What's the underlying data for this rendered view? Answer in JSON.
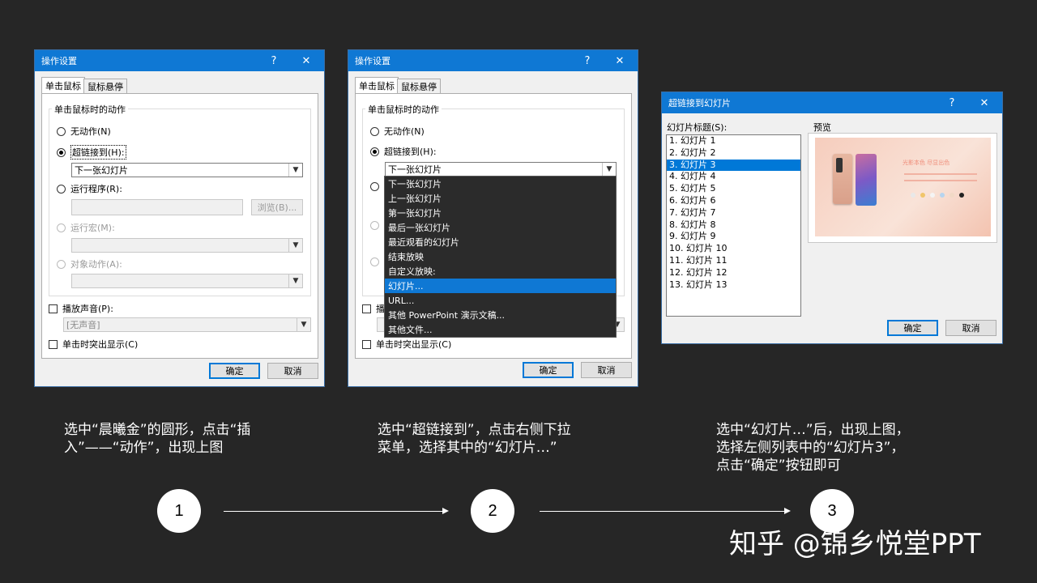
{
  "dialog1": {
    "title": "操作设置",
    "help": "?",
    "close": "✕",
    "tabs": [
      "单击鼠标",
      "鼠标悬停"
    ],
    "group_label": "单击鼠标时的动作",
    "radio_none": "无动作(N)",
    "radio_hyperlink": "超链接到(H):",
    "hyperlink_value": "下一张幻灯片",
    "radio_program": "运行程序(R):",
    "browse": "浏览(B)...",
    "radio_macro": "运行宏(M):",
    "radio_object": "对象动作(A):",
    "check_sound": "播放声音(P):",
    "sound_value": "[无声音]",
    "check_highlight": "单击时突出显示(C)",
    "ok": "确定",
    "cancel": "取消"
  },
  "dialog2": {
    "title": "操作设置",
    "help": "?",
    "close": "✕",
    "tabs": [
      "单击鼠标",
      "鼠标悬停"
    ],
    "group_label": "单击鼠标时的动作",
    "radio_none": "无动作(N)",
    "radio_hyperlink": "超链接到(H):",
    "hyperlink_value": "下一张幻灯片",
    "dropdown_items": [
      "下一张幻灯片",
      "上一张幻灯片",
      "第一张幻灯片",
      "最后一张幻灯片",
      "最近观看的幻灯片",
      "结束放映",
      "自定义放映:",
      "幻灯片...",
      "URL...",
      "其他 PowerPoint 演示文稿...",
      "其他文件..."
    ],
    "selected_index": 7,
    "check_sound_partial": "播",
    "check_highlight_partial": "单击时突出显示(C)",
    "ok": "确定",
    "cancel": "取消"
  },
  "dialog3": {
    "title": "超链接到幻灯片",
    "help": "?",
    "close": "✕",
    "list_label": "幻灯片标题(S):",
    "preview_label": "预览",
    "slides": [
      "1. 幻灯片 1",
      "2. 幻灯片 2",
      "3. 幻灯片 3",
      "4. 幻灯片 4",
      "5. 幻灯片 5",
      "6. 幻灯片 6",
      "7. 幻灯片 7",
      "8. 幻灯片 8",
      "9. 幻灯片 9",
      "10. 幻灯片 10",
      "11. 幻灯片 11",
      "12. 幻灯片 12",
      "13. 幻灯片 13"
    ],
    "selected_index": 2,
    "preview_heading": "光影本色  尽显出色",
    "ok": "确定",
    "cancel": "取消"
  },
  "captions": {
    "step1": [
      "选中“晨曦金”的圆形，点击“插",
      "入”——“动作”，出现上图"
    ],
    "step2": [
      "选中“超链接到”，点击右侧下拉",
      "菜单，选择其中的“幻灯片…”"
    ],
    "step3": [
      "选中“幻灯片…”后，出现上图，",
      "选择左侧列表中的“幻灯片3”，",
      "点击“确定”按钮即可"
    ]
  },
  "steps": [
    "1",
    "2",
    "3"
  ],
  "watermark": "知乎 @锦乡悦堂PPT",
  "colors": {
    "background": "#262626",
    "titlebar": "#0f78d4",
    "selection": "#0078d7",
    "dropdown_bg": "#2b2b2b"
  }
}
